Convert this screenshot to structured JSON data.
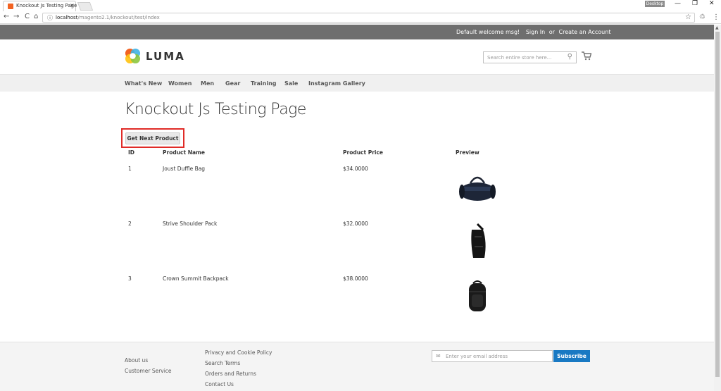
{
  "browser": {
    "tab_title": "Knockout Js Testing Page",
    "tab_close": "×",
    "profile_label": "Desktop",
    "url_host": "localhost",
    "url_path": "/magento2.1/knockout/test/index",
    "win_minimize": "—",
    "win_restore": "❐",
    "win_close": "✕",
    "back": "←",
    "forward": "→",
    "reload": "C",
    "home": "⌂",
    "star": "☆",
    "menu": "⋮",
    "ext": "♲"
  },
  "header": {
    "welcome": "Default welcome msg!",
    "sign_in": "Sign In",
    "or": "or",
    "create_account": "Create an Account"
  },
  "logo": {
    "text": "LUMA"
  },
  "search": {
    "placeholder": "Search entire store here...",
    "icon": "search-icon"
  },
  "nav": {
    "items": [
      "What's New",
      "Women",
      "Men",
      "Gear",
      "Training",
      "Sale",
      "Instagram Gallery"
    ]
  },
  "main": {
    "title": "Knockout Js Testing Page",
    "get_next_label": "Get Next Product",
    "columns": [
      "ID",
      "Product Name",
      "Product Price",
      "Preview"
    ],
    "rows": [
      {
        "id": "1",
        "name": "Joust Duffle Bag",
        "price": "$34.0000",
        "preview": "duffle-bag-image"
      },
      {
        "id": "2",
        "name": "Strive Shoulder Pack",
        "price": "$32.0000",
        "preview": "shoulder-pack-image"
      },
      {
        "id": "3",
        "name": "Crown Summit Backpack",
        "price": "$38.0000",
        "preview": "backpack-image"
      }
    ]
  },
  "footer": {
    "col1": [
      "About us",
      "Customer Service"
    ],
    "col2": [
      "Privacy and Cookie Policy",
      "Search Terms",
      "Orders and Returns",
      "Contact Us"
    ],
    "newsletter_placeholder": "Enter your email address",
    "subscribe_label": "Subscribe"
  },
  "colors": {
    "accent": "#1979c3",
    "highlight": "#e02b27",
    "header_bg": "#6e6e6e"
  }
}
